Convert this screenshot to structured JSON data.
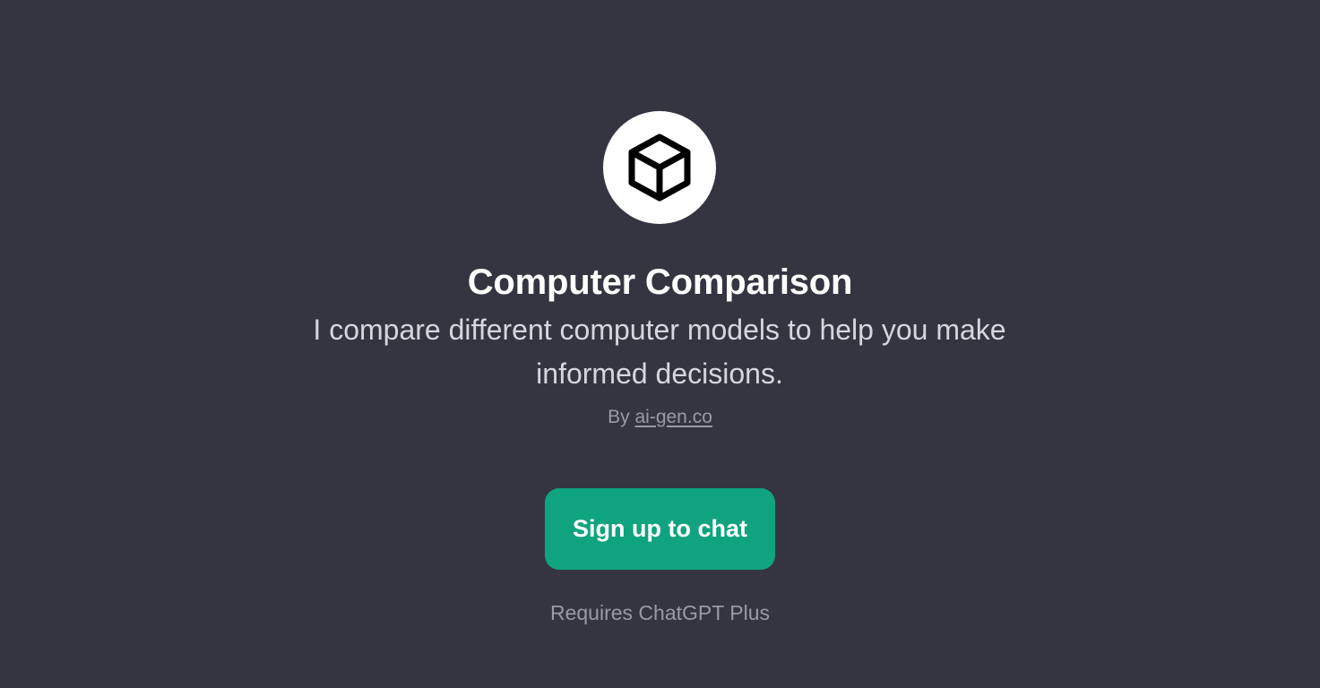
{
  "gpt": {
    "icon": "cube-icon",
    "title": "Computer Comparison",
    "description": "I compare different computer models to help you make informed decisions.",
    "byline_prefix": "By",
    "author": "ai-gen.co"
  },
  "cta": {
    "label": "Sign up to chat"
  },
  "requirement": "Requires ChatGPT Plus",
  "colors": {
    "background": "#343541",
    "accent": "#10a37f",
    "avatar_bg": "#ffffff"
  }
}
